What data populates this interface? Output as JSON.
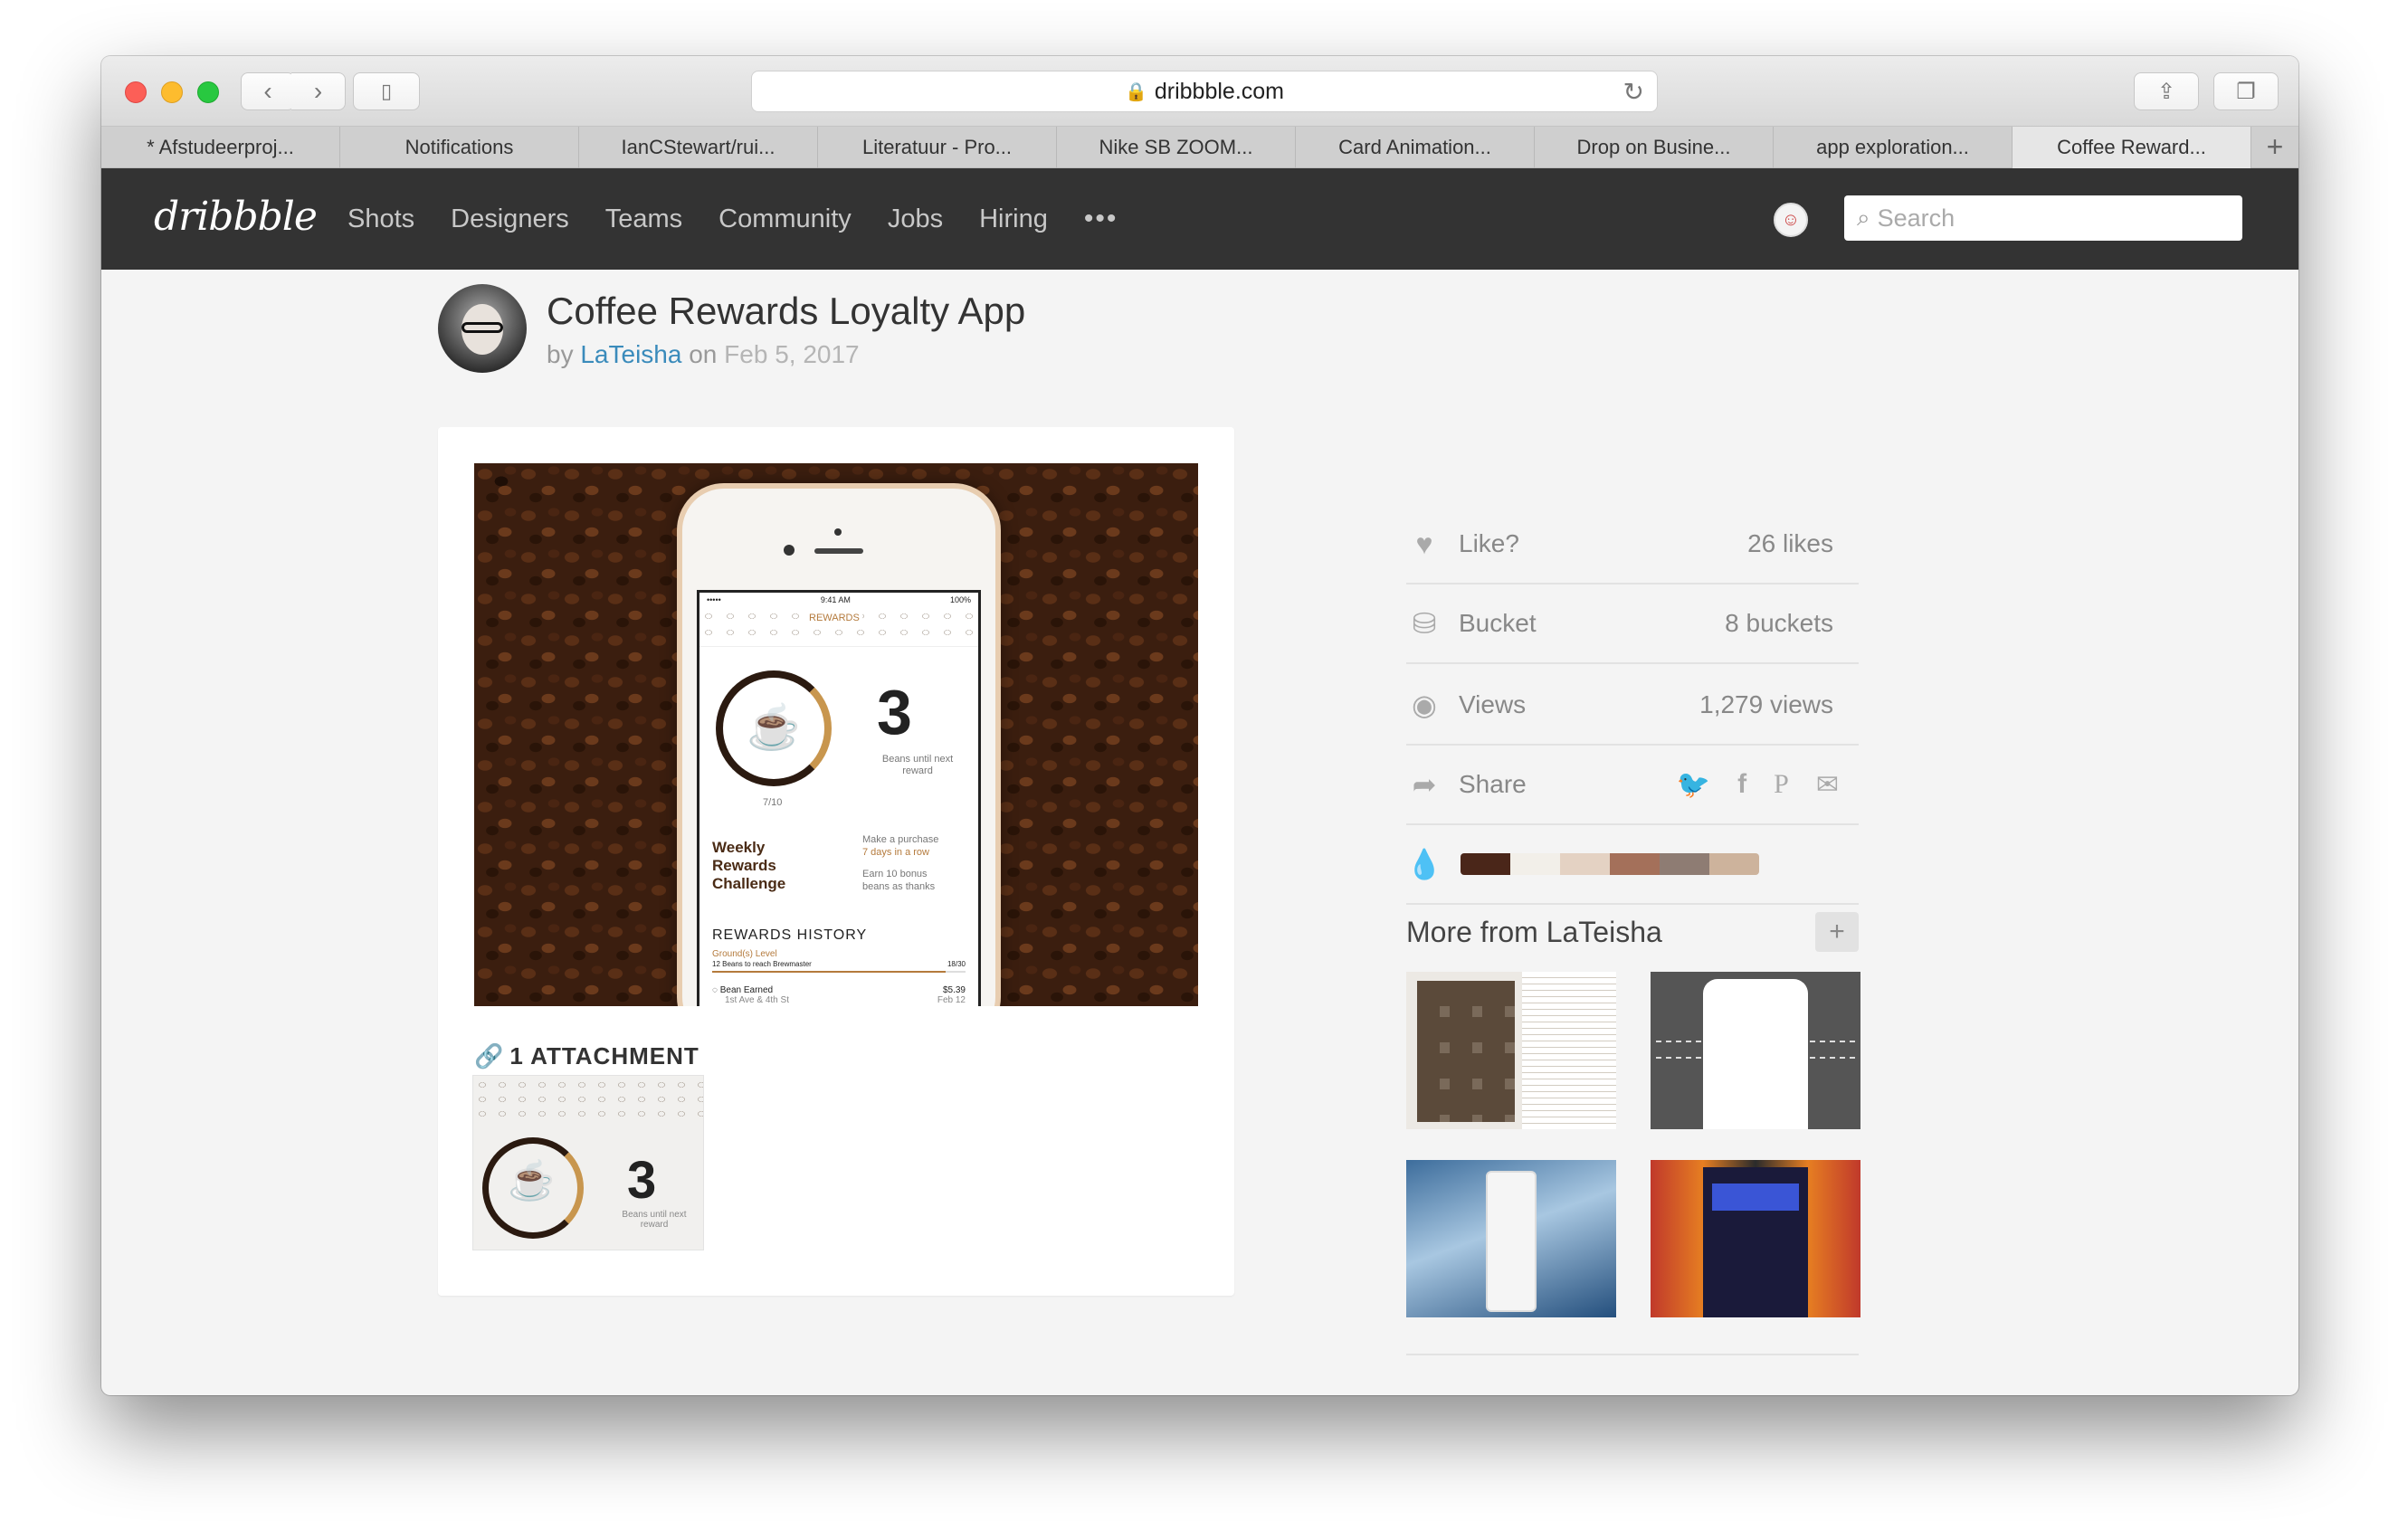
{
  "browser": {
    "url": "dribbble.com",
    "tabs": [
      "* Afstudeerproj...",
      "Notifications",
      "IanCStewart/rui...",
      "Literatuur - Pro...",
      "Nike SB ZOOM...",
      "Card Animation...",
      "Drop on Busine...",
      "app exploration...",
      "Coffee Reward..."
    ],
    "active_tab_index": 8
  },
  "nav": {
    "logo": "dribbble",
    "links": [
      "Shots",
      "Designers",
      "Teams",
      "Community",
      "Jobs",
      "Hiring"
    ],
    "more": "•••",
    "search_placeholder": "Search"
  },
  "shot": {
    "title": "Coffee Rewards Loyalty App",
    "by": "by",
    "author": "LaTeisha",
    "on": "on",
    "date": "Feb 5, 2017",
    "app_screen": {
      "status_left": "••••• ",
      "status_time": "9:41 AM",
      "status_right": "100%",
      "header": "REWARDS",
      "count": "3",
      "count_sub": "Beans until next reward",
      "progress_label": "7/10",
      "challenge_title": "Weekly Rewards Challenge",
      "challenge_line1": "Make a purchase",
      "challenge_line2": "7 days in a row",
      "challenge_line3": "Earn 10 bonus",
      "challenge_line4": "beans as thanks",
      "history_title": "REWARDS HISTORY",
      "history_level": "Ground(s) Level",
      "history_progress": "12 Beans to reach Brewmaster",
      "history_progress_value": "18/30",
      "history_row_title": "Bean Earned",
      "history_row_sub": "1st Ave & 4th St",
      "history_row_amount": "$5.39",
      "history_row_date": "Feb 12"
    },
    "attachments_label": "1 ATTACHMENT",
    "attachment_count_text": "3",
    "attachment_sub": "Beans until next reward"
  },
  "stats": {
    "like_label": "Like?",
    "likes": "26 likes",
    "bucket_label": "Bucket",
    "buckets": "8 buckets",
    "views_label": "Views",
    "views": "1,279 views",
    "share_label": "Share",
    "share_icons": [
      "twitter-icon",
      "facebook-icon",
      "pinterest-icon",
      "mail-icon"
    ],
    "palette": [
      "#4a2619",
      "#f2efe9",
      "#e4d2c3",
      "#a4705a",
      "#8e7c73",
      "#cdb39c"
    ]
  },
  "more": {
    "title": "More from LaTeisha"
  }
}
